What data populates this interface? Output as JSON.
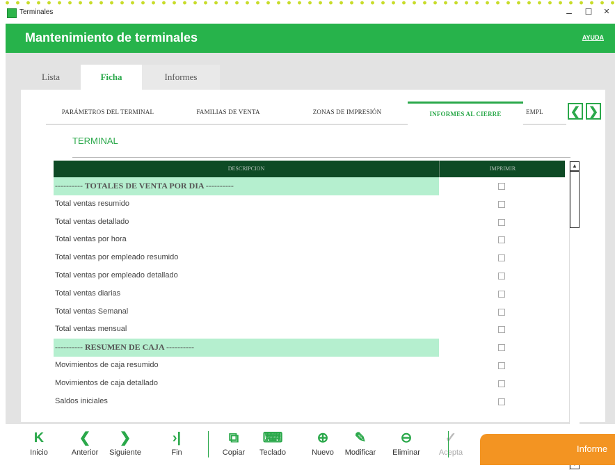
{
  "window": {
    "title": "Terminales",
    "minimize": "–",
    "maximize": "☐",
    "close": "✕"
  },
  "header": {
    "title": "Mantenimiento de terminales",
    "help": "AYUDA"
  },
  "tabs": [
    "Lista",
    "Ficha",
    "Informes"
  ],
  "active_tab": "Ficha",
  "subtabs": [
    "PARÁMETROS DEL TERMINAL",
    "FAMILIAS DE VENTA",
    "ZONAS DE IMPRESIÓN",
    "INFORMES AL CIERRE",
    "EMPL"
  ],
  "active_subtab": "INFORMES AL CIERRE",
  "section_label": "TERMINAL",
  "grid": {
    "columns": [
      "DESCRIPCION",
      "IMPRIMIR"
    ],
    "rows": [
      {
        "label": "---------- TOTALES DE VENTA POR DIA ----------",
        "section": true,
        "checked": false
      },
      {
        "label": "Total ventas resumido",
        "section": false,
        "checked": false
      },
      {
        "label": "Total ventas detallado",
        "section": false,
        "checked": false
      },
      {
        "label": "Total ventas por hora",
        "section": false,
        "checked": false
      },
      {
        "label": "Total ventas por empleado resumido",
        "section": false,
        "checked": false
      },
      {
        "label": "Total ventas por empleado detallado",
        "section": false,
        "checked": false
      },
      {
        "label": "Total ventas diarias",
        "section": false,
        "checked": false
      },
      {
        "label": "Total ventas Semanal",
        "section": false,
        "checked": false
      },
      {
        "label": "Total ventas mensual",
        "section": false,
        "checked": false
      },
      {
        "label": "---------- RESUMEN DE CAJA ----------",
        "section": true,
        "checked": false
      },
      {
        "label": "Movimientos de caja resumido",
        "section": false,
        "checked": false
      },
      {
        "label": "Movimientos de caja detallado",
        "section": false,
        "checked": false
      },
      {
        "label": "Saldos iniciales",
        "section": false,
        "checked": false
      }
    ]
  },
  "toolbar": [
    {
      "label": "Inicio",
      "icon": "K",
      "icon_name": "first-icon",
      "enabled": true
    },
    {
      "label": "Anterior",
      "icon": "❮",
      "icon_name": "previous-icon",
      "enabled": true
    },
    {
      "label": "Siguiente",
      "icon": "❯",
      "icon_name": "next-icon",
      "enabled": true
    },
    {
      "label": "Fin",
      "icon": "›|",
      "icon_name": "last-icon",
      "enabled": true
    },
    {
      "label": "Copiar",
      "icon": "⧉",
      "icon_name": "copy-icon",
      "enabled": true
    },
    {
      "label": "Teclado",
      "icon": "⌨",
      "icon_name": "keyboard-icon",
      "enabled": true
    },
    {
      "label": "Nuevo",
      "icon": "⊕",
      "icon_name": "plus-circle-icon",
      "enabled": true
    },
    {
      "label": "Modificar",
      "icon": "✎",
      "icon_name": "pencil-icon",
      "enabled": true
    },
    {
      "label": "Eliminar",
      "icon": "⊖",
      "icon_name": "minus-circle-icon",
      "enabled": true
    },
    {
      "label": "Acepta",
      "icon": "✓",
      "icon_name": "check-circle-icon",
      "enabled": false
    }
  ],
  "overlay_banner": "Informe",
  "colors": {
    "brand_green": "#27b34b",
    "grid_header": "#0e4a25",
    "section_row": "#b5efcf",
    "orange": "#f39422",
    "dots": "#c8dc2a"
  }
}
